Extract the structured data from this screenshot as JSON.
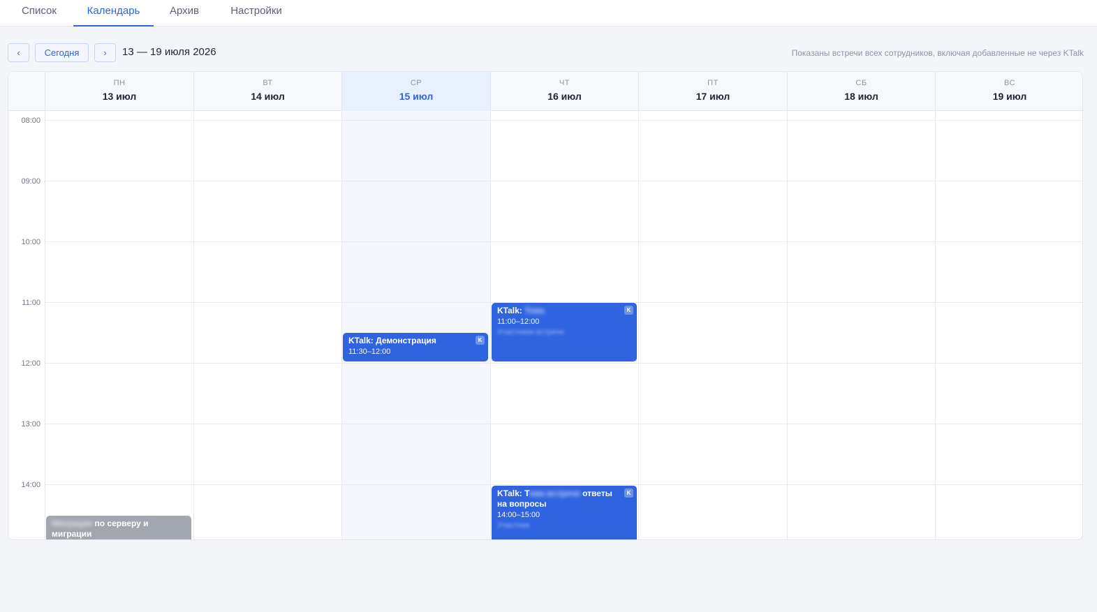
{
  "tabs": [
    {
      "label": "Список",
      "active": false
    },
    {
      "label": "Календарь",
      "active": true
    },
    {
      "label": "Архив",
      "active": false
    },
    {
      "label": "Настройки",
      "active": false
    }
  ],
  "nav": {
    "prev": "‹",
    "today": "Сегодня",
    "next": "›",
    "range": "13 — 19 июля 2026",
    "note": "Показаны встречи всех сотрудников, включая добавленные не через KTalk"
  },
  "days": [
    {
      "dow": "ПН",
      "date": "13 июл"
    },
    {
      "dow": "ВТ",
      "date": "14 июл"
    },
    {
      "dow": "СР",
      "date": "15 июл",
      "today": true
    },
    {
      "dow": "ЧТ",
      "date": "16 июл"
    },
    {
      "dow": "ПТ",
      "date": "17 июл"
    },
    {
      "dow": "СБ",
      "date": "18 июл"
    },
    {
      "dow": "ВС",
      "date": "19 июл"
    }
  ],
  "hours": [
    "08:00",
    "09:00",
    "10:00",
    "11:00",
    "12:00",
    "13:00",
    "14:00"
  ],
  "events": {
    "wed_demo": {
      "title": "KTalk: Демонстрация",
      "time": "11:30–12:00",
      "badge": "K"
    },
    "thu_11": {
      "title": "KTalk:",
      "title_redacted": "Тема",
      "time": "11:00–12:00",
      "sub": "Участники встречи",
      "badge": "K"
    },
    "thu_14": {
      "title_prefix": "KTalk: Т",
      "title_redacted": "ема встречи",
      "title": "ответы на вопросы",
      "time": "14:00–15:00",
      "sub": "Участник",
      "badge": "K"
    },
    "mon_14": {
      "title_redacted": "Миграция",
      "title": "по серверу и миграции"
    }
  },
  "colors": {
    "accent": "#2f63e0",
    "event_gray": "#a2a6ae",
    "today_bg": "#e9f0fd"
  }
}
